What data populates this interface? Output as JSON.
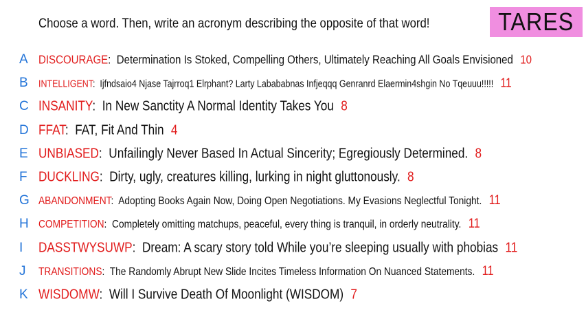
{
  "badge": "TARES",
  "prompt": "Choose a word. Then, write an acronym describing the opposite of that word!",
  "entries": [
    {
      "letter": "A",
      "word": "DISCOURAGE",
      "definition": "Determination Is Stoked, Compelling Others, Ultimately Reaching All Goals Envisioned",
      "number": "10"
    },
    {
      "letter": "B",
      "word": "INTELLIGENT",
      "definition": "Ijfndsaio4 Njase Tajrroq1 Elrphant? Larty Labababnas Infjeqqq Genranrd Elaermin4shgin No Tqeuuu!!!!!",
      "number": "11"
    },
    {
      "letter": "C",
      "word": "INSANITY",
      "definition": "In New Sanctity A Normal Identity Takes You",
      "number": "8"
    },
    {
      "letter": "D",
      "word": "FFAT",
      "definition": "FAT, Fit And Thin",
      "number": "4"
    },
    {
      "letter": "E",
      "word": "UNBIASED",
      "definition": "Unfailingly Never Based In Actual Sincerity; Egregiously Determined.",
      "number": "8"
    },
    {
      "letter": "F",
      "word": "DUCKLING",
      "definition": "Dirty, ugly, creatures killing, lurking in night gluttonously.",
      "number": "8"
    },
    {
      "letter": "G",
      "word": "ABANDONMENT",
      "definition": "Adopting Books Again Now, Doing Open Negotiations. My Evasions Neglectful Tonight.",
      "number": "11"
    },
    {
      "letter": "H",
      "word": "COMPETITION",
      "definition": "Completely omitting matchups, peaceful, every thing is tranquil, in orderly neutrality.",
      "number": "11"
    },
    {
      "letter": "I",
      "word": "DASSTWYSUWP",
      "definition": "Dream: A scary story told While you’re sleeping usually with phobias",
      "number": "11"
    },
    {
      "letter": "J",
      "word": "TRANSITIONS",
      "definition": "The Randomly Abrupt New Slide Incites Timeless Information On Nuanced Statements.",
      "number": "11"
    },
    {
      "letter": "K",
      "word": "WISDOMW",
      "definition": "Will I Survive Death Of Moonlight (WISDOM)",
      "number": "7"
    }
  ]
}
